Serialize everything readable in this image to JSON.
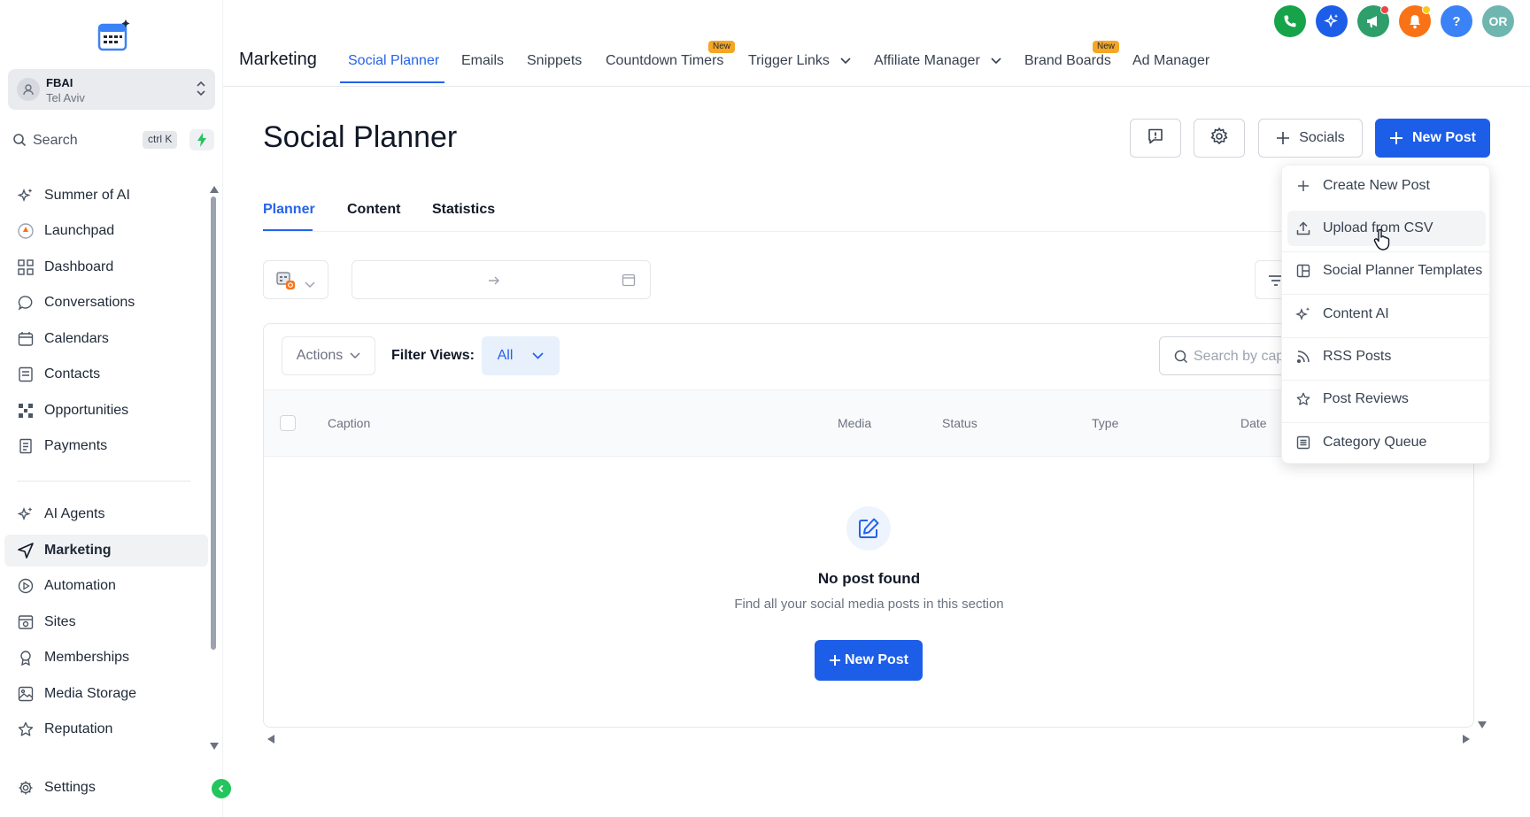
{
  "sidebar": {
    "account": {
      "name": "FBAI",
      "location": "Tel Aviv"
    },
    "search": {
      "placeholder": "Search",
      "shortcut": "ctrl K"
    },
    "items": [
      {
        "label": "Summer of AI",
        "icon": "sparkle-icon"
      },
      {
        "label": "Launchpad",
        "icon": "rocket-icon"
      },
      {
        "label": "Dashboard",
        "icon": "dashboard-icon"
      },
      {
        "label": "Conversations",
        "icon": "chat-icon"
      },
      {
        "label": "Calendars",
        "icon": "calendar-icon"
      },
      {
        "label": "Contacts",
        "icon": "contacts-icon"
      },
      {
        "label": "Opportunities",
        "icon": "opportunities-icon"
      },
      {
        "label": "Payments",
        "icon": "payments-icon"
      },
      {
        "label": "AI Agents",
        "icon": "sparkle-icon"
      },
      {
        "label": "Marketing",
        "icon": "send-icon",
        "active": true
      },
      {
        "label": "Automation",
        "icon": "automation-icon"
      },
      {
        "label": "Sites",
        "icon": "sites-icon"
      },
      {
        "label": "Memberships",
        "icon": "membership-icon"
      },
      {
        "label": "Media Storage",
        "icon": "image-icon"
      },
      {
        "label": "Reputation",
        "icon": "star-icon"
      }
    ],
    "settings_label": "Settings"
  },
  "topnav": {
    "section": "Marketing",
    "tabs": [
      {
        "label": "Social Planner",
        "active": true
      },
      {
        "label": "Emails"
      },
      {
        "label": "Snippets"
      },
      {
        "label": "Countdown Timers",
        "badge": "New"
      },
      {
        "label": "Trigger Links",
        "dropdown": true
      },
      {
        "label": "Affiliate Manager",
        "dropdown": true
      },
      {
        "label": "Brand Boards",
        "badge": "New"
      },
      {
        "label": "Ad Manager"
      }
    ],
    "avatar_initials": "OR",
    "help_glyph": "?"
  },
  "page": {
    "title": "Social Planner",
    "socials_label": "Socials",
    "new_post_label": "New Post",
    "subtabs": [
      "Planner",
      "Content",
      "Statistics"
    ],
    "actions_label": "Actions",
    "filter_views_label": "Filter Views:",
    "filter_views_value": "All",
    "search_placeholder": "Search by cap",
    "columns": [
      "Caption",
      "Media",
      "Status",
      "Type",
      "Date"
    ],
    "empty_title": "No post found",
    "empty_subtitle": "Find all your social media posts in this section",
    "empty_button": "New Post"
  },
  "dropdown": {
    "items": [
      {
        "label": "Create New Post",
        "icon": "plus-icon"
      },
      {
        "label": "Upload from CSV",
        "icon": "upload-icon"
      },
      {
        "label": "Social Planner Templates",
        "icon": "template-icon"
      },
      {
        "label": "Content AI",
        "icon": "sparkle-icon"
      },
      {
        "label": "RSS Posts",
        "icon": "rss-icon"
      },
      {
        "label": "Post Reviews",
        "icon": "star-icon"
      },
      {
        "label": "Category Queue",
        "icon": "queue-icon"
      }
    ]
  },
  "colors": {
    "primary": "#1d5ee8",
    "active_tab": "#2563eb",
    "phone": "#16a34a",
    "bell": "#f97316",
    "help": "#3b82f6",
    "avatar": "#6fb6b0"
  }
}
